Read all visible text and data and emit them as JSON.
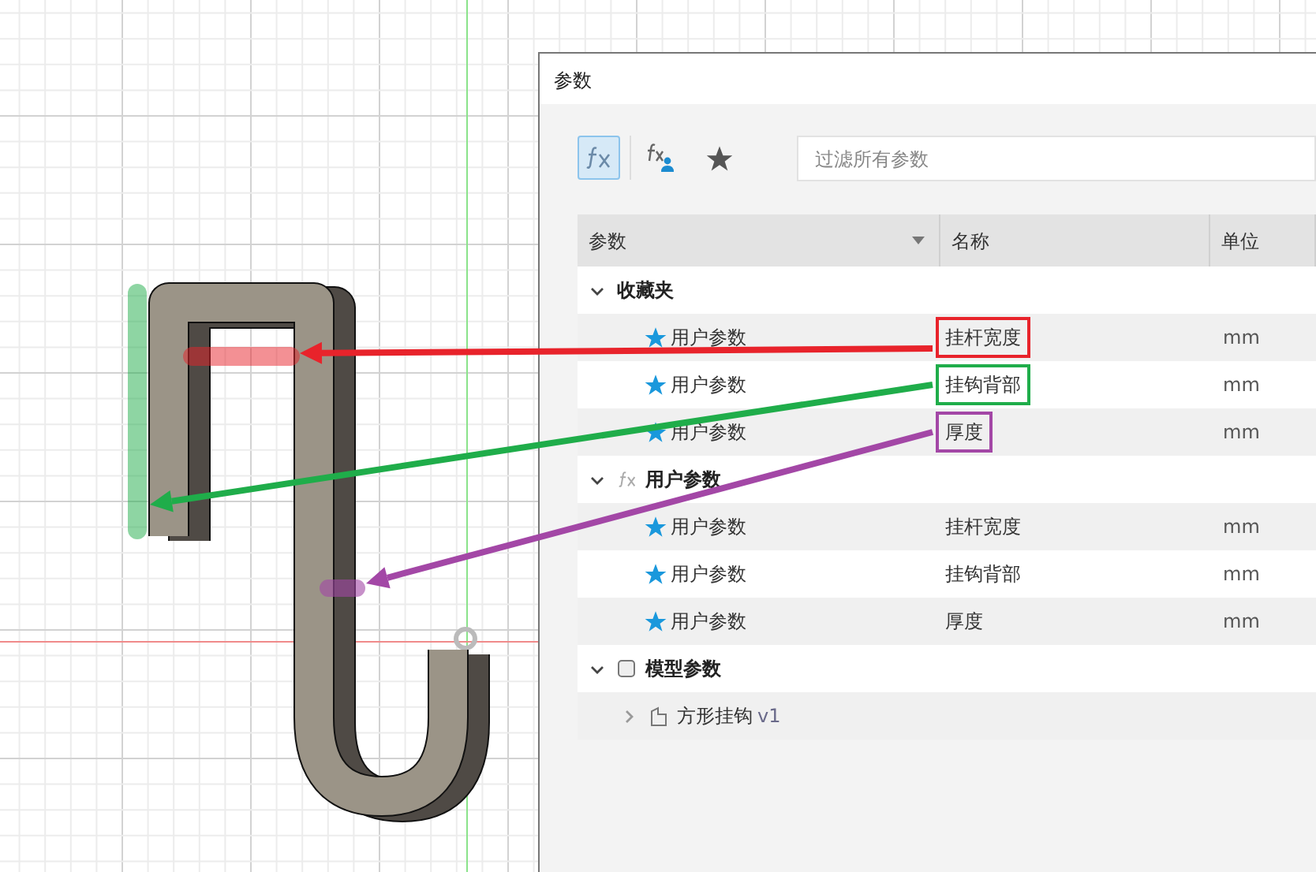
{
  "dialog": {
    "title": "参数"
  },
  "toolbar": {
    "buttons": [
      {
        "kind": "fx",
        "selected": true
      },
      {
        "kind": "user-fx",
        "selected": false
      },
      {
        "kind": "star",
        "selected": false
      }
    ],
    "search": {
      "placeholder": "过滤所有参数"
    }
  },
  "table": {
    "columns": [
      {
        "label": "参数",
        "sort_caret": true
      },
      {
        "label": "名称",
        "sort_caret": false
      },
      {
        "label": "单位",
        "sort_caret": false
      }
    ]
  },
  "groups": [
    {
      "label": "收藏夹",
      "kind": "favorites",
      "expanded": true,
      "rows": [
        {
          "kind": "param",
          "favorite": true,
          "parameter": "用户参数",
          "name": "挂杆宽度",
          "unit": "mm",
          "color": "#e8232b"
        },
        {
          "kind": "param",
          "favorite": true,
          "parameter": "用户参数",
          "name": "挂钩背部",
          "unit": "mm",
          "color": "#1fad4a"
        },
        {
          "kind": "param",
          "favorite": true,
          "parameter": "用户参数",
          "name": "厚度",
          "unit": "mm",
          "color": "#a347a6"
        }
      ]
    },
    {
      "label": "用户参数",
      "kind": "user",
      "expanded": true,
      "rows": [
        {
          "kind": "param",
          "favorite": true,
          "parameter": "用户参数",
          "name": "挂杆宽度",
          "unit": "mm"
        },
        {
          "kind": "param",
          "favorite": true,
          "parameter": "用户参数",
          "name": "挂钩背部",
          "unit": "mm"
        },
        {
          "kind": "param",
          "favorite": true,
          "parameter": "用户参数",
          "name": "厚度",
          "unit": "mm"
        }
      ]
    },
    {
      "label": "模型参数",
      "kind": "model",
      "expanded": true,
      "rows": [
        {
          "kind": "component",
          "expanded": false,
          "parameter": "方形挂钩",
          "version": "v1"
        }
      ]
    }
  ]
}
